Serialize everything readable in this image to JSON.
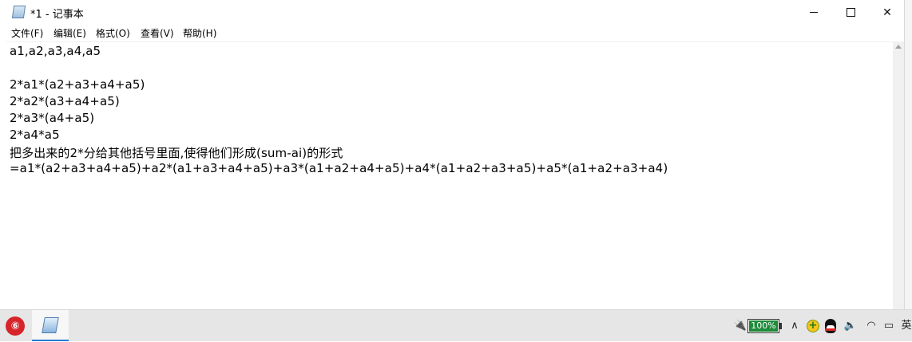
{
  "window": {
    "title": "*1 - 记事本",
    "controls": {
      "minimize_icon": "minimize-icon",
      "maximize_icon": "maximize-icon",
      "close_symbol": "✕"
    }
  },
  "menubar": {
    "items": [
      {
        "label": "文件(F)"
      },
      {
        "label": "编辑(E)"
      },
      {
        "label": "格式(O)"
      },
      {
        "label": "查看(V)"
      },
      {
        "label": "帮助(H)"
      }
    ]
  },
  "editor": {
    "lines": [
      "a1,a2,a3,a4,a5",
      "",
      "2*a1*(a2+a3+a4+a5)",
      "2*a2*(a3+a4+a5)",
      "2*a3*(a4+a5)",
      "2*a4*a5",
      "把多出来的2*分给其他括号里面,使得他们形成(sum-ai)的形式",
      "=a1*(a2+a3+a4+a5)+a2*(a1+a3+a4+a5)+a3*(a1+a2+a4+a5)+a4*(a1+a2+a3+a5)+a5*(a1+a2+a3+a4)"
    ]
  },
  "taskbar": {
    "apps": [
      {
        "icon": "netease-music-icon",
        "glyph": "⑥"
      },
      {
        "icon": "notepad-icon"
      }
    ],
    "tray": {
      "battery_level": 100,
      "battery_text": "100%",
      "chevron": "∧",
      "speaker": "🔈",
      "wifi": "◠",
      "keyboard": "▭",
      "ime": "英"
    }
  },
  "colors": {
    "accent": "#2a7bd4",
    "battery_green": "#1e8b3a",
    "netease_red": "#d6242a",
    "taskbar_bg": "#e6e6e6"
  }
}
